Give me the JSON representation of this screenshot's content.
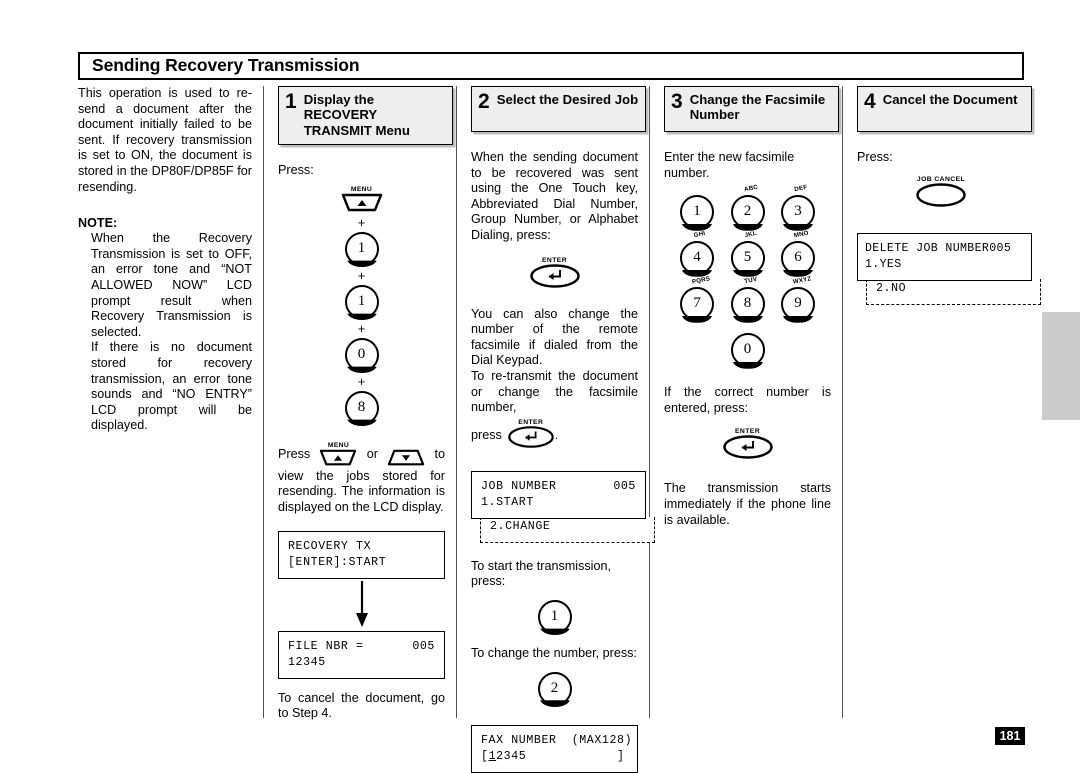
{
  "page": {
    "title": "Sending Recovery Transmission",
    "number": "181"
  },
  "intro": {
    "paragraph": "This operation is used to re-send a document after the document initially failed to be sent. If recovery transmission is set to ON, the document is stored in the DP80F/DP85F for resending.",
    "note_label": "NOTE:",
    "note_1": "When the Recovery Transmission is set to OFF, an error tone and “NOT ALLOWED NOW” LCD prompt result when Recovery Transmission is selected.",
    "note_2": "If there is no document stored for recovery transmission, an error tone sounds and “NO ENTRY” LCD prompt will be displayed."
  },
  "steps": [
    {
      "number": "1",
      "title": "Display the RECOVERY TRANSMIT Menu",
      "press_label": "Press:",
      "keys": [
        {
          "type": "menu-up",
          "label": "MENU"
        },
        {
          "type": "plus",
          "label": "+"
        },
        {
          "type": "round",
          "label": "1"
        },
        {
          "type": "plus",
          "label": "+"
        },
        {
          "type": "round",
          "label": "1"
        },
        {
          "type": "plus",
          "label": "+"
        },
        {
          "type": "round",
          "label": "0"
        },
        {
          "type": "plus",
          "label": "+"
        },
        {
          "type": "round",
          "label": "8"
        }
      ],
      "inline_press_prefix": "Press",
      "inline_press_or": "or",
      "inline_press_suffix": "to",
      "menu_up_label": "MENU",
      "body_after_keys": "view the jobs stored for resending. The information is displayed on the LCD display.",
      "lcd_1": {
        "line1": "RECOVERY TX",
        "line2": "[ENTER]:START"
      },
      "lcd_2": {
        "line1_left": "FILE NBR =",
        "line1_right": "005",
        "line2": "12345"
      },
      "footer": "To cancel the document, go to Step 4."
    },
    {
      "number": "2",
      "title": "Select the Desired Job",
      "para_1": "When the sending document to be recovered was sent using the One Touch key, Abbreviated Dial Number, Group Number, or Alphabet Dialing, press:",
      "enter_label": "ENTER",
      "para_2": "You can also change the number of the remote facsimile if dialed from the Dial Keypad.",
      "para_3": "To re-transmit the document or change the facsimile number,",
      "para_4_prefix": "press",
      "para_4_suffix": ".",
      "lcd_1": {
        "line1_left": "JOB NUMBER",
        "line1_right": "005",
        "line2": "1.START",
        "overflow": "2.CHANGE"
      },
      "para_5": "To start the transmission, press:",
      "key_start": "1",
      "para_6": "To change the number, press:",
      "key_change": "2",
      "lcd_2": {
        "line1": "FAX NUMBER  (MAX128)",
        "line2_pre": "[",
        "line2_cursor": "1",
        "line2_post": "2345            ]"
      }
    },
    {
      "number": "3",
      "title": "Change the Facsimile Number",
      "para_1": "Enter the new facsimile number.",
      "keypad": [
        {
          "digit": "1",
          "letters": ""
        },
        {
          "digit": "2",
          "letters": "ABC"
        },
        {
          "digit": "3",
          "letters": "DEF"
        },
        {
          "digit": "4",
          "letters": "GHI"
        },
        {
          "digit": "5",
          "letters": "JKL"
        },
        {
          "digit": "6",
          "letters": "MNO"
        },
        {
          "digit": "7",
          "letters": "PQRS"
        },
        {
          "digit": "8",
          "letters": "TUV"
        },
        {
          "digit": "9",
          "letters": "WXYZ"
        },
        {
          "digit": "0",
          "letters": ""
        }
      ],
      "para_2": "If the correct number is entered, press:",
      "enter_label": "ENTER",
      "para_3": "The transmission starts immediately if the phone line is available."
    },
    {
      "number": "4",
      "title": "Cancel the Document",
      "press_label": "Press:",
      "job_cancel_label": "JOB CANCEL",
      "lcd_1": {
        "line1": "DELETE JOB NUMBER005",
        "line2": "1.YES",
        "overflow": "2.NO"
      }
    }
  ],
  "colors": {
    "step_box_bg": "#eeeeee",
    "step_box_shadow": "#bdbdbd",
    "side_tab": "#cccccc",
    "page_badge_bg": "#000000",
    "page_badge_fg": "#ffffff"
  }
}
